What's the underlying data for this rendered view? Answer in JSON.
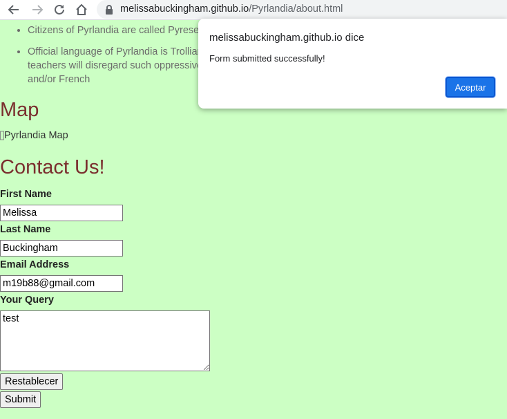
{
  "browser": {
    "url_domain": "melissabuckingham.github.io",
    "url_path": "/Pyrlandia/about.html",
    "back_icon": "arrow-left-icon",
    "forward_icon": "arrow-right-icon",
    "reload_icon": "reload-icon",
    "home_icon": "home-icon",
    "lock_icon": "lock-icon"
  },
  "facts": [
    "Citizens of Pyrlandia are called Pyrese",
    "Official language of Pyrlandia is Trollian. teachers will disregard such oppressive and/or French"
  ],
  "map": {
    "heading": "Map",
    "image_alt": "Pyrlandia Map"
  },
  "contact": {
    "heading": "Contact Us!",
    "first_name_label": "First Name",
    "first_name_value": "Melissa",
    "last_name_label": "Last Name",
    "last_name_value": "Buckingham",
    "email_label": "Email Address",
    "email_value": "m19b88@gmail.com",
    "query_label": "Your Query",
    "query_value": "test",
    "reset_label": "Restablecer",
    "submit_label": "Submit"
  },
  "dialog": {
    "title": "melissabuckingham.github.io dice",
    "message": "Form submitted successfully!",
    "ok_label": "Aceptar"
  },
  "colors": {
    "page_background": "#ccffc4",
    "heading": "#7a2e2e",
    "dialog_button": "#1a73e8"
  }
}
